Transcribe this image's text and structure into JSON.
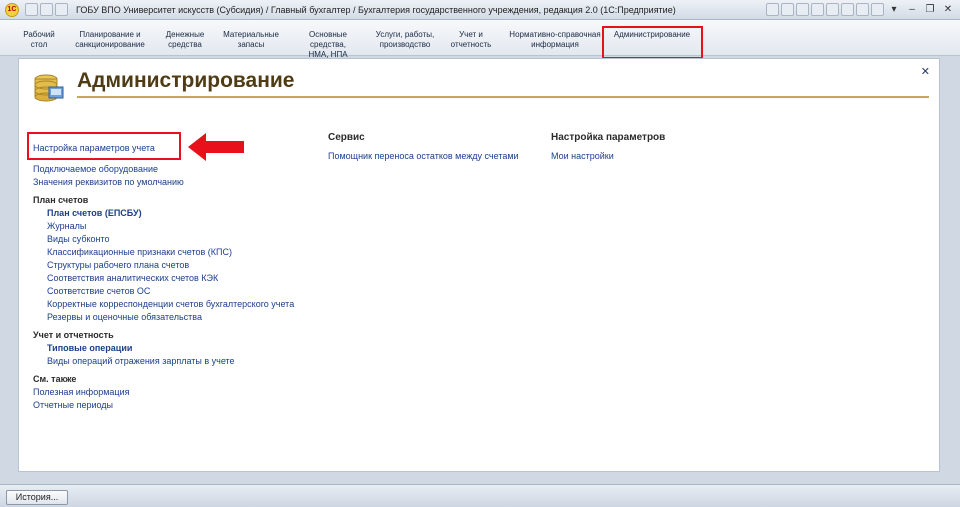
{
  "window": {
    "title": "ГОБУ ВПО Университет искусств (Субсидия) / Главный бухгалтер / Бухгалтерия государственного учреждения, редакция 2.0 (1С:Предприятие)"
  },
  "sections": [
    {
      "line1": "Рабочий",
      "line2": "стол"
    },
    {
      "line1": "Планирование и",
      "line2": "санкционирование"
    },
    {
      "line1": "Денежные",
      "line2": "средства"
    },
    {
      "line1": "Материальные",
      "line2": "запасы"
    },
    {
      "line1": "Основные средства,",
      "line2": "НМА, НПА"
    },
    {
      "line1": "Услуги, работы,",
      "line2": "производство"
    },
    {
      "line1": "Учет и",
      "line2": "отчетность"
    },
    {
      "line1": "Нормативно-справочная",
      "line2": "информация"
    },
    {
      "line1": "Администрирование",
      "line2": ""
    }
  ],
  "page": {
    "title": "Администрирование",
    "main_link": "Настройка параметров учета",
    "col1": {
      "links": [
        "Подключаемое оборудование",
        "Значения реквизитов по умолчанию"
      ],
      "chart_of_accounts": {
        "heading": "План счетов",
        "items": [
          "План счетов (ЕПСБУ)",
          "Журналы",
          "Виды субконто",
          "Классификационные признаки счетов (КПС)",
          "Структуры рабочего плана счетов",
          "Соответствия аналитических счетов КЭК",
          "Соответствие счетов ОС",
          "Корректные корреспонденции счетов бухгалтерского учета",
          "Резервы и оценочные обязательства"
        ]
      },
      "reporting": {
        "heading": "Учет и отчетность",
        "items": [
          "Типовые операции",
          "Виды операций отражения зарплаты в учете"
        ]
      },
      "see_also": {
        "heading": "См. также",
        "items": [
          "Полезная информация",
          "Отчетные периоды"
        ]
      }
    },
    "col2": {
      "heading": "Сервис",
      "items": [
        "Помощник переноса остатков между счетами"
      ]
    },
    "col3": {
      "heading": "Настройка параметров",
      "items": [
        "Мои настройки"
      ]
    }
  },
  "bottom": {
    "history_label": "История..."
  },
  "colors": {
    "highlight": "#e8101a",
    "link": "#1b3f8c",
    "title": "#4f3c16"
  }
}
